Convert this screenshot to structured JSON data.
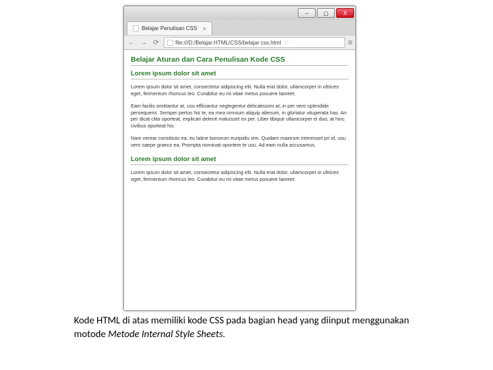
{
  "window": {
    "min_label": "–",
    "max_label": "▢",
    "close_label": "X"
  },
  "tab": {
    "title": "Belajar Penulisan CSS",
    "close": "×"
  },
  "address": {
    "back": "←",
    "fwd": "→",
    "reload": "⟳",
    "url": "file:///D:/Belajar.HTML/CSS/belajar  css.html",
    "star": "☆",
    "menu": "≡"
  },
  "page": {
    "h1": "Belajar Aturan dan Cara Penulisan Kode CSS",
    "h2a": "Lorem ipsum dolor sit amet",
    "p1": "Lorem ipsum dolor sit amet, consectetur adipiscing elit. Nulla erat dolor, ullamcorper in ultrices eget, fermentum rhoncus leo. Curabitur eu mi vitae metus posuere laoreet.",
    "p2": "Eam facilis omittantur at, usu efficiantur neglegentur delicatissimi at, in per vero splendide persequeris. Semper pertus his te, ea mea omnium aliquip alienum, in gloriatur vituperata has. An per dicat clita oporteat, explicari delenit maluisset ex per. Liber tibique ullamcorper ei duo, at hinc civibus oporteat his.",
    "p3": "Nam verear constituto ea, eu latine bonorum euripidis vim. Quidam maiorum interesset pri id, usu vero saepe graeco ea. Prompta nominati oportere te usu. Ad eam nulla accusamus.",
    "h2b": "Lorem ipsum dolor sit amet",
    "p4": "Lorem ipsum dolor sit amet, consectetur adipiscing elit. Nulla erat dolor, ullamcorper in ultrices eget, fermentum rhoncus leo. Curabitur eu mi vitae metus posuere laoreet."
  },
  "caption": {
    "pre": "Kode HTML di atas memiliki kode CSS pada bagian head yang diinput menggunakan motode ",
    "ital": "Metode Internal Style Sheets.",
    "post": ""
  }
}
